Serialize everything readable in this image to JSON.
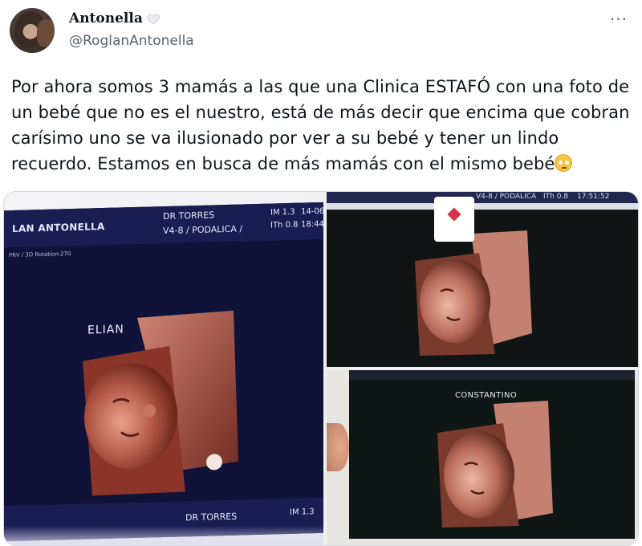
{
  "author": {
    "display_name": "Antonella",
    "handle": "@RoglanAntonella",
    "badge_icon": "white-heart-icon"
  },
  "more_label": "···",
  "tweet": {
    "line1": "Por ahora somos 3 mamás a las que una Clinica ESTAFÓ con una foto de",
    "line2": "un bebé que no es el nuestro, está de más decir que encima que cobran",
    "line3": "carísimo uno se va ilusionado por ver a su bebé y tener un lindo",
    "line4": "recuerdo. Estamos en busca de más mamás con el mismo bebé",
    "emoji": "rolling-eyes-emoji"
  },
  "media": {
    "left": {
      "patient": "LAN ANTONELLA",
      "doctor": "DR TORRES",
      "probe": "V4-8 / PODALICA /",
      "im": "IM  1.3",
      "ith": "ITh 0.8",
      "date": "14-06",
      "time": "18:44",
      "mode": "PRV / 3D Rotation:270",
      "label": "ELIAN",
      "footer_doctor": "DR TORRES",
      "footer_im": "IM  1.3"
    },
    "right_top": {
      "probe": "V4-8 / PODALICA",
      "ith": "ITh 0.8",
      "time": "17:51:52"
    },
    "right_bottom": {
      "label": "CONSTANTINO"
    }
  }
}
